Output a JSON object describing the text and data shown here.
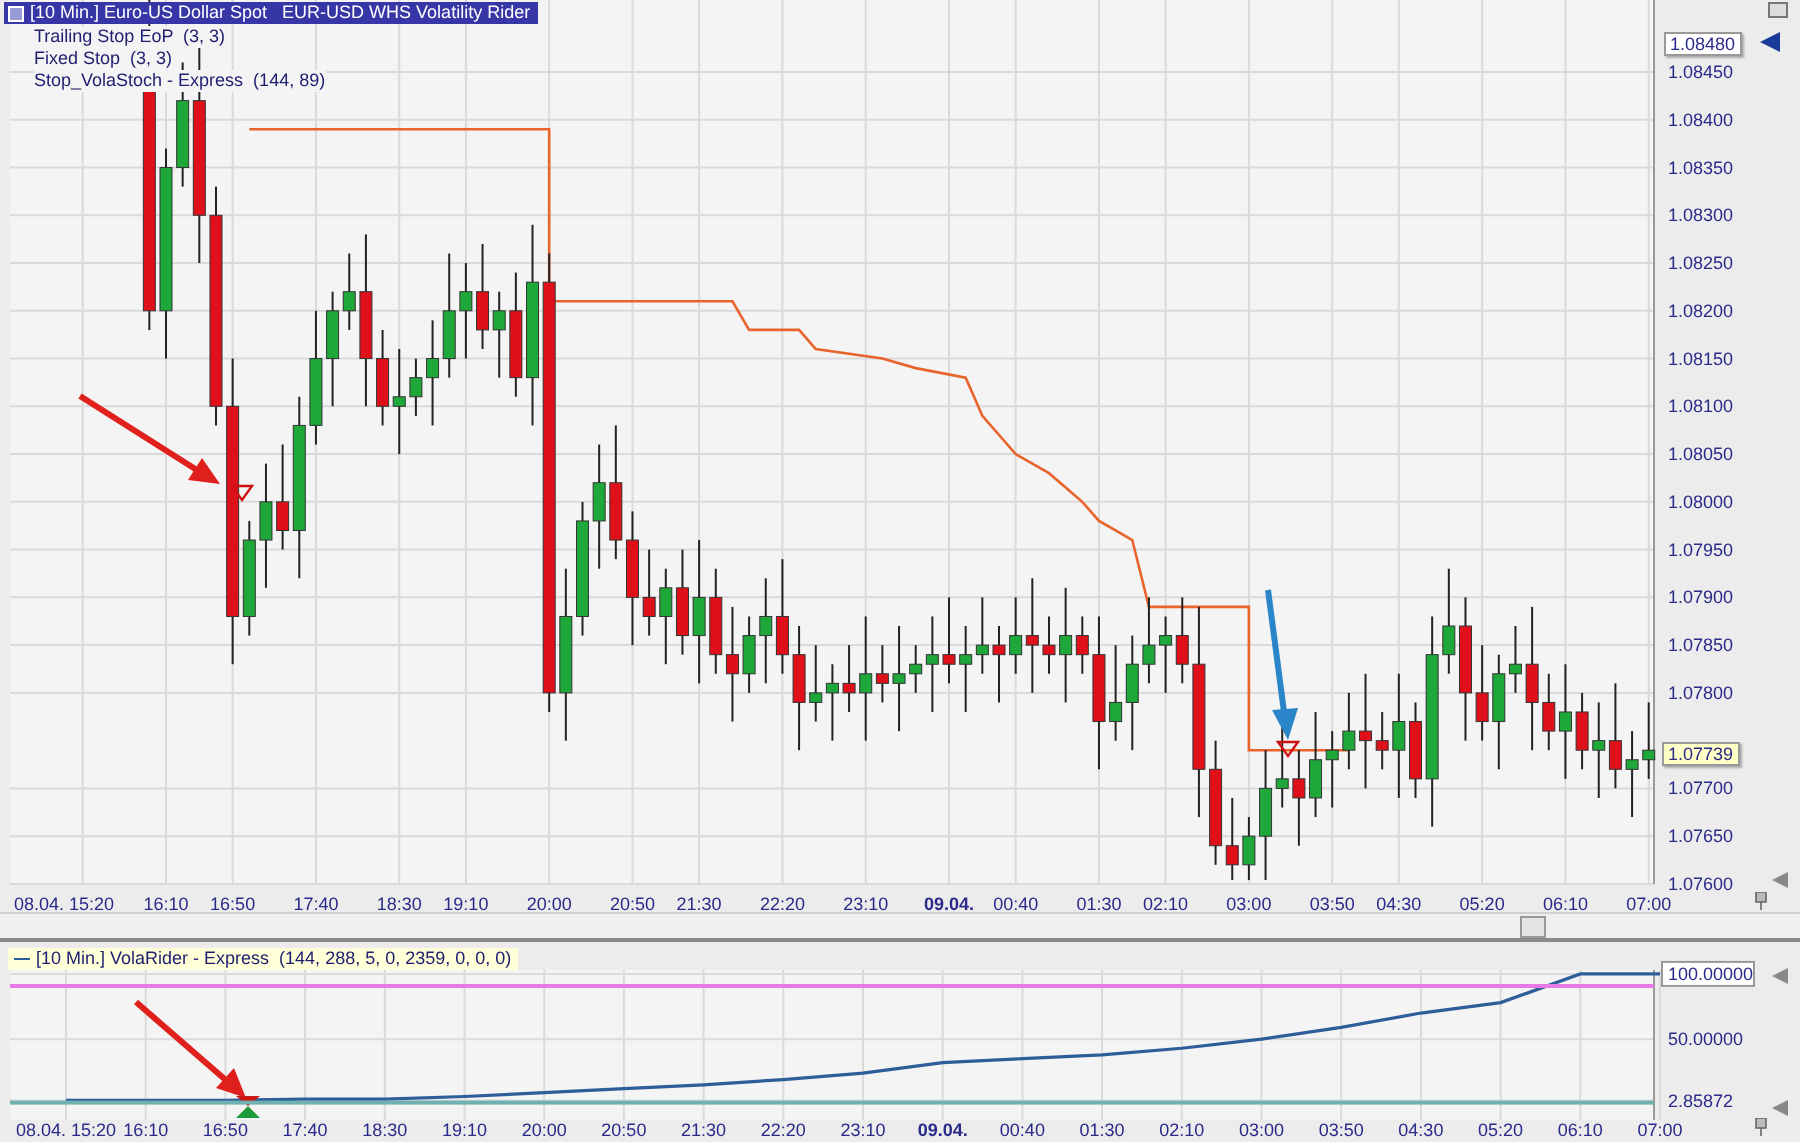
{
  "price_panel": {
    "title": "[10 Min.] Euro-US Dollar Spot   EUR-USD WHS Volatility Rider",
    "legend": [
      "Trailing Stop EoP  (3, 3)",
      "Fixed Stop  (3, 3)",
      "Stop_VolaStoch - Express  (144, 89)"
    ],
    "price_ticks": [
      "1.08450",
      "1.08400",
      "1.08350",
      "1.08300",
      "1.08250",
      "1.08200",
      "1.08150",
      "1.08100",
      "1.08050",
      "1.08000",
      "1.07950",
      "1.07900",
      "1.07850",
      "1.07800",
      "1.07700",
      "1.07650",
      "1.07600"
    ],
    "high_tag": "1.08480",
    "last_price_tag": "1.07739",
    "time_labels": [
      {
        "label": "08.04.  15:20",
        "bold": false
      },
      {
        "label": "16:10",
        "bold": false
      },
      {
        "label": "16:50",
        "bold": false
      },
      {
        "label": "17:40",
        "bold": false
      },
      {
        "label": "18:30",
        "bold": false
      },
      {
        "label": "19:10",
        "bold": false
      },
      {
        "label": "20:00",
        "bold": false
      },
      {
        "label": "20:50",
        "bold": false
      },
      {
        "label": "21:30",
        "bold": false
      },
      {
        "label": "22:20",
        "bold": false
      },
      {
        "label": "23:10",
        "bold": false
      },
      {
        "label": "09.04.",
        "bold": true
      },
      {
        "label": "00:40",
        "bold": false
      },
      {
        "label": "01:30",
        "bold": false
      },
      {
        "label": "02:10",
        "bold": false
      },
      {
        "label": "03:00",
        "bold": false
      },
      {
        "label": "03:50",
        "bold": false
      },
      {
        "label": "04:30",
        "bold": false
      },
      {
        "label": "05:20",
        "bold": false
      },
      {
        "label": "06:10",
        "bold": false
      },
      {
        "label": "07:00",
        "bold": false
      }
    ]
  },
  "indicator_panel": {
    "legend_prefix": "[10 Min.]",
    "legend_params": "(144, 288, 5, 0, 2359, 0, 0, 0)",
    "chart_data": {
      "type": "line",
      "grid": true,
      "ylim": [
        -12,
        103
      ],
      "categories": [
        "08.04.  15:20",
        "16:10",
        "16:50",
        "17:40",
        "18:30",
        "19:10",
        "20:00",
        "20:50",
        "21:30",
        "22:20",
        "23:10",
        "09.04.",
        "00:40",
        "01:30",
        "02:10",
        "03:00",
        "03:50",
        "04:30",
        "05:20",
        "06:10",
        "07:00"
      ],
      "series": [
        {
          "name": "VolaRider - Express",
          "color": "#2e5e9a",
          "values": [
            3,
            3,
            3,
            4,
            4,
            6,
            9,
            12,
            15,
            19,
            24,
            32,
            35,
            38,
            43,
            50,
            59,
            70,
            78,
            100,
            100
          ]
        }
      ],
      "yticks": [
        {
          "value": 2.85872,
          "label": "2.85872"
        },
        {
          "value": 50,
          "label": "50.00000"
        },
        {
          "value": 100,
          "label": "100.00000"
        }
      ]
    }
  }
}
